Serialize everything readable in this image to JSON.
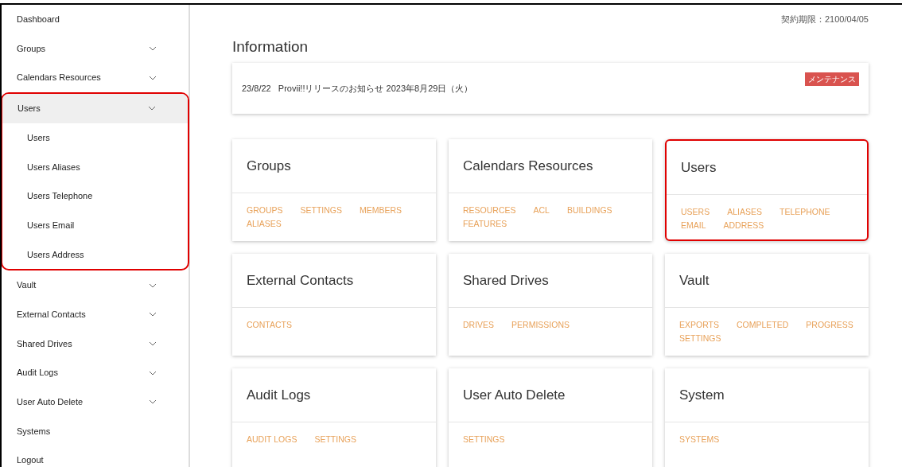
{
  "sidebar": {
    "items": [
      {
        "label": "Dashboard",
        "expandable": false,
        "expanded": false,
        "highlighted": false
      },
      {
        "label": "Groups",
        "expandable": true,
        "expanded": false,
        "highlighted": false
      },
      {
        "label": "Calendars Resources",
        "expandable": true,
        "expanded": false,
        "highlighted": false
      },
      {
        "label": "Users",
        "expandable": true,
        "expanded": true,
        "highlighted": true,
        "children": [
          {
            "label": "Users"
          },
          {
            "label": "Users Aliases"
          },
          {
            "label": "Users Telephone"
          },
          {
            "label": "Users Email"
          },
          {
            "label": "Users Address"
          }
        ]
      },
      {
        "label": "Vault",
        "expandable": true,
        "expanded": false,
        "highlighted": false
      },
      {
        "label": "External Contacts",
        "expandable": true,
        "expanded": false,
        "highlighted": false
      },
      {
        "label": "Shared Drives",
        "expandable": true,
        "expanded": false,
        "highlighted": false
      },
      {
        "label": "Audit Logs",
        "expandable": true,
        "expanded": false,
        "highlighted": false
      },
      {
        "label": "User Auto Delete",
        "expandable": true,
        "expanded": false,
        "highlighted": false
      },
      {
        "label": "Systems",
        "expandable": false,
        "expanded": false,
        "highlighted": false
      },
      {
        "label": "Logout",
        "expandable": false,
        "expanded": false,
        "highlighted": false
      }
    ]
  },
  "contract": "契約期限：2100/04/05",
  "information": {
    "title": "Information",
    "notice": {
      "date": "23/8/22",
      "text": "Provii!!リリースのお知らせ 2023年8月29日（火）",
      "tag": "メンテナンス"
    }
  },
  "cards": [
    {
      "title": "Groups",
      "highlighted": false,
      "links": [
        "GROUPS",
        "SETTINGS",
        "MEMBERS",
        "ALIASES"
      ]
    },
    {
      "title": "Calendars Resources",
      "highlighted": false,
      "links": [
        "RESOURCES",
        "ACL",
        "BUILDINGS",
        "FEATURES"
      ]
    },
    {
      "title": "Users",
      "highlighted": true,
      "links": [
        "USERS",
        "ALIASES",
        "TELEPHONE",
        "EMAIL",
        "ADDRESS"
      ]
    },
    {
      "title": "External Contacts",
      "highlighted": false,
      "links": [
        "CONTACTS"
      ]
    },
    {
      "title": "Shared Drives",
      "highlighted": false,
      "links": [
        "DRIVES",
        "PERMISSIONS"
      ]
    },
    {
      "title": "Vault",
      "highlighted": false,
      "links": [
        "EXPORTS",
        "COMPLETED",
        "PROGRESS",
        "SETTINGS"
      ]
    },
    {
      "title": "Audit Logs",
      "highlighted": false,
      "links": [
        "AUDIT LOGS",
        "SETTINGS"
      ]
    },
    {
      "title": "User Auto Delete",
      "highlighted": false,
      "links": [
        "SETTINGS"
      ]
    },
    {
      "title": "System",
      "highlighted": false,
      "links": [
        "SYSTEMS"
      ]
    }
  ]
}
